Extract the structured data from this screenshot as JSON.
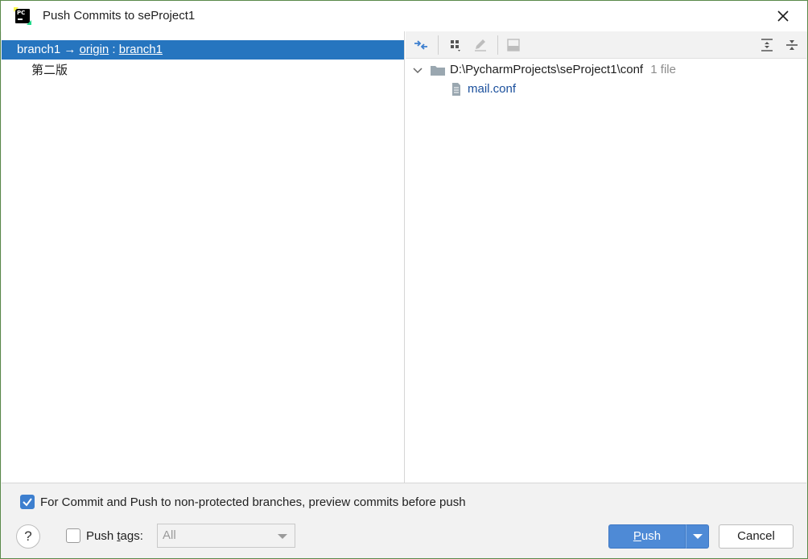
{
  "window": {
    "title": "Push Commits to seProject1"
  },
  "left": {
    "branch": {
      "local": "branch1",
      "arrow": "→",
      "remote": "origin",
      "separator": ":",
      "remote_branch": "branch1"
    },
    "commits": [
      {
        "message": "第二版"
      }
    ]
  },
  "toolbar": {
    "icons": [
      "diff-icon",
      "group-by-icon",
      "edit-icon",
      "preview-icon",
      "expand-all-icon",
      "collapse-all-icon"
    ]
  },
  "tree": {
    "folder_path": "D:\\PycharmProjects\\seProject1\\conf",
    "folder_count": "1 file",
    "files": [
      {
        "name": "mail.conf"
      }
    ]
  },
  "footer": {
    "preview_checkbox_label": "For Commit and Push to non-protected branches, preview commits before push",
    "preview_checked": true,
    "help_label": "?",
    "push_tags_pre": "Push ",
    "push_tags_mnemonic": "t",
    "push_tags_post": "ags:",
    "push_tags_checked": false,
    "tags_select_value": "All",
    "push_mnemonic": "P",
    "push_rest": "ush",
    "cancel_label": "Cancel"
  },
  "colors": {
    "selection": "#2675bf",
    "primary_button": "#4e8ad6",
    "checkbox_checked": "#3d7fcf",
    "file_link": "#1a4f9c",
    "muted_text": "#8c8c8c"
  }
}
